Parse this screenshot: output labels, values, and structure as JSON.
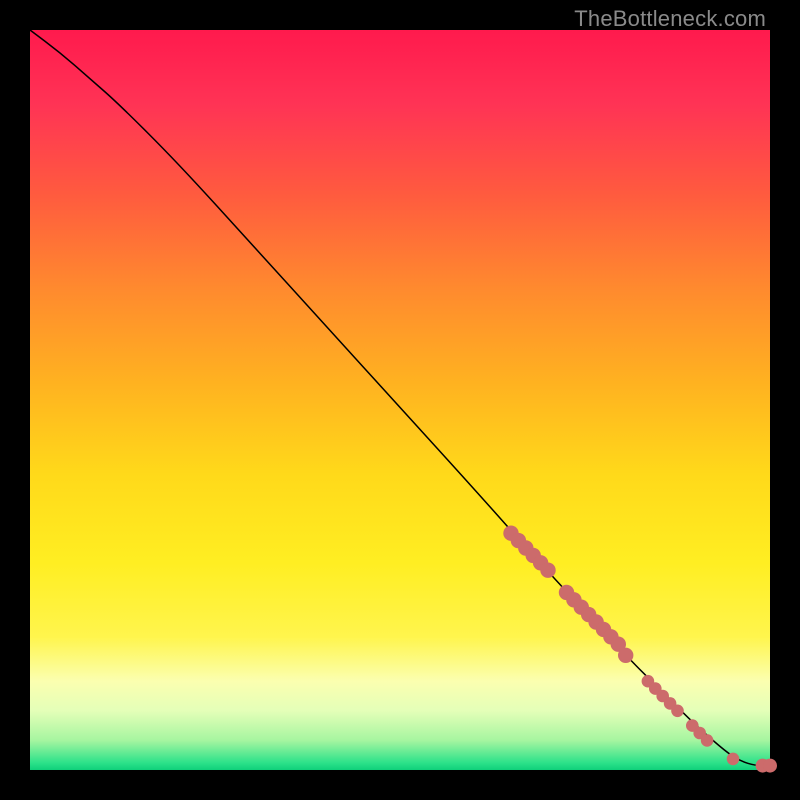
{
  "watermark": "TheBottleneck.com",
  "colors": {
    "dot_fill": "#cc6b6b",
    "curve_stroke": "#000000",
    "frame_bg": "#000000",
    "gradient_top": "#ff1a4d",
    "gradient_bottom": "#0fd07a"
  },
  "chart_data": {
    "type": "line",
    "title": "",
    "xlabel": "",
    "ylabel": "",
    "xlim": [
      0,
      100
    ],
    "ylim": [
      0,
      100
    ],
    "grid": false,
    "legend": false,
    "series": [
      {
        "name": "bottleneck-curve",
        "x": [
          0,
          4,
          8,
          12,
          20,
          30,
          40,
          50,
          60,
          68,
          74,
          80,
          86,
          90,
          94,
          96,
          98,
          100
        ],
        "y": [
          100,
          97,
          93.5,
          90,
          82,
          71,
          60,
          49,
          38,
          29,
          22.5,
          16,
          10,
          6,
          2.5,
          1.2,
          0.6,
          0.6
        ]
      }
    ],
    "points": [
      {
        "name": "cluster-a-1",
        "x": 65,
        "y": 32,
        "r": 1.1
      },
      {
        "name": "cluster-a-2",
        "x": 66,
        "y": 31,
        "r": 1.1
      },
      {
        "name": "cluster-a-3",
        "x": 67,
        "y": 30,
        "r": 1.1
      },
      {
        "name": "cluster-a-4",
        "x": 68,
        "y": 29,
        "r": 1.1
      },
      {
        "name": "cluster-a-5",
        "x": 69,
        "y": 28,
        "r": 1.1
      },
      {
        "name": "cluster-a-6",
        "x": 70,
        "y": 27,
        "r": 1.1
      },
      {
        "name": "cluster-b-1",
        "x": 72.5,
        "y": 24,
        "r": 1.1
      },
      {
        "name": "cluster-b-2",
        "x": 73.5,
        "y": 23,
        "r": 1.1
      },
      {
        "name": "cluster-b-3",
        "x": 74.5,
        "y": 22,
        "r": 1.1
      },
      {
        "name": "cluster-b-4",
        "x": 75.5,
        "y": 21,
        "r": 1.1
      },
      {
        "name": "cluster-b-5",
        "x": 76.5,
        "y": 20,
        "r": 1.1
      },
      {
        "name": "cluster-b-6",
        "x": 77.5,
        "y": 19,
        "r": 1.1
      },
      {
        "name": "cluster-b-7",
        "x": 78.5,
        "y": 18,
        "r": 1.1
      },
      {
        "name": "cluster-b-8",
        "x": 79.5,
        "y": 17,
        "r": 1.1
      },
      {
        "name": "cluster-b-9",
        "x": 80.5,
        "y": 15.5,
        "r": 1.1
      },
      {
        "name": "cluster-c-1",
        "x": 83.5,
        "y": 12,
        "r": 0.9
      },
      {
        "name": "cluster-c-2",
        "x": 84.5,
        "y": 11,
        "r": 0.9
      },
      {
        "name": "cluster-c-3",
        "x": 85.5,
        "y": 10,
        "r": 0.9
      },
      {
        "name": "cluster-c-4",
        "x": 86.5,
        "y": 9,
        "r": 0.9
      },
      {
        "name": "cluster-c-5",
        "x": 87.5,
        "y": 8,
        "r": 0.9
      },
      {
        "name": "cluster-d-1",
        "x": 89.5,
        "y": 6,
        "r": 0.9
      },
      {
        "name": "cluster-d-2",
        "x": 90.5,
        "y": 5,
        "r": 0.9
      },
      {
        "name": "cluster-d-3",
        "x": 91.5,
        "y": 4,
        "r": 0.9
      },
      {
        "name": "tail-1",
        "x": 95,
        "y": 1.5,
        "r": 0.9
      },
      {
        "name": "tail-2",
        "x": 99,
        "y": 0.6,
        "r": 1.0
      },
      {
        "name": "tail-3",
        "x": 100,
        "y": 0.6,
        "r": 1.0
      }
    ]
  }
}
